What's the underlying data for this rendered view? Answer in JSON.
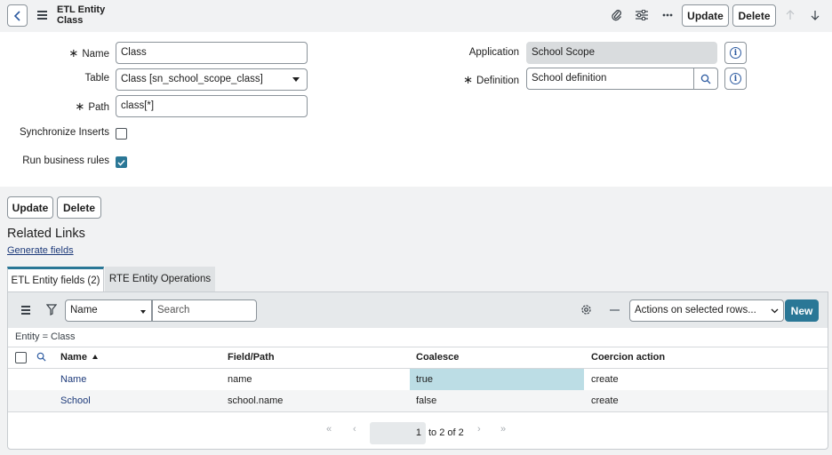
{
  "header": {
    "title_line1": "ETL Entity",
    "title_line2": "Class",
    "update_label": "Update",
    "delete_label": "Delete"
  },
  "form": {
    "name": {
      "label": "Name",
      "value": "Class"
    },
    "table": {
      "label": "Table",
      "value": "Class [sn_school_scope_class]"
    },
    "path": {
      "label": "Path",
      "value": "class[*]"
    },
    "sync_inserts": {
      "label": "Synchronize Inserts",
      "checked": false
    },
    "run_rules": {
      "label": "Run business rules",
      "checked": true
    },
    "application": {
      "label": "Application",
      "value": "School Scope"
    },
    "definition": {
      "label": "Definition",
      "value": "School definition"
    }
  },
  "bottom": {
    "update_label": "Update",
    "delete_label": "Delete",
    "related_title": "Related Links",
    "generate_fields": "Generate fields"
  },
  "tabs": [
    {
      "label": "ETL Entity fields (2)",
      "active": true
    },
    {
      "label": "RTE Entity Operations",
      "active": false
    }
  ],
  "list": {
    "filter_field": "Name",
    "search_placeholder": "Search",
    "actions_label": "Actions on selected rows...",
    "new_label": "New",
    "breadcrumb": "Entity = Class",
    "columns": [
      "Name",
      "Field/Path",
      "Coalesce",
      "Coercion action"
    ],
    "rows": [
      {
        "name": "Name",
        "path": "name",
        "coalesce": "true",
        "coercion": "create"
      },
      {
        "name": "School",
        "path": "school.name",
        "coalesce": "false",
        "coercion": "create"
      }
    ],
    "pager": {
      "current": "1",
      "range_text": "to 2 of 2"
    }
  },
  "colors": {
    "accent": "#2a7796",
    "highlight": "#bcdde5",
    "link": "#1d3a7a"
  }
}
